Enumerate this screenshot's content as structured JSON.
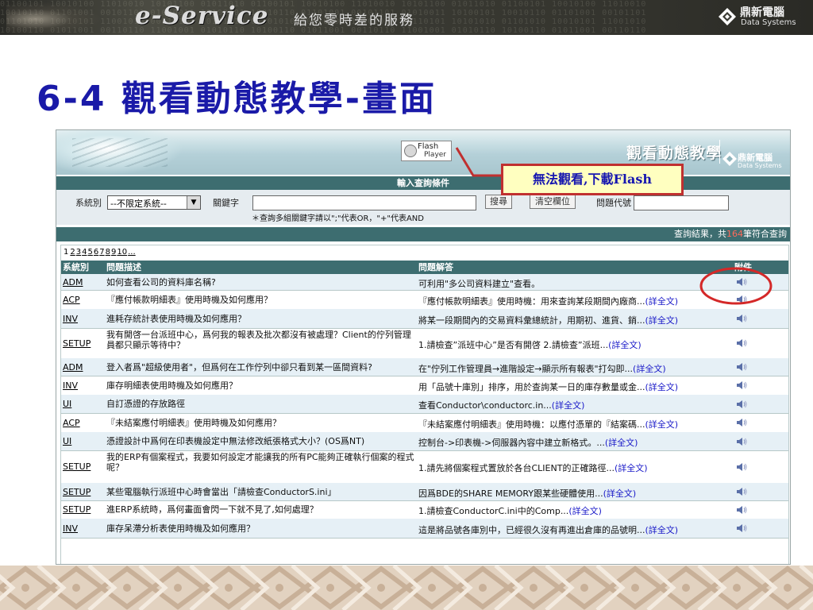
{
  "banner": {
    "logo_text": "e-Service",
    "tagline": "給您零時差的服務",
    "brand_cn": "鼎新電腦",
    "brand_en": "Data Systems"
  },
  "slide_title": "6-4 觀看動態教學-畫面",
  "app": {
    "flash_badge_line1": "Flash",
    "flash_badge_line2": "Player",
    "title": "觀看動態教學",
    "logo_cn": "鼎新電腦",
    "logo_en": "Data Systems",
    "query_title": "輸入查詢條件",
    "query": {
      "system_label": "系統別",
      "system_value": "--不限定系統--",
      "keyword_label": "關鍵字",
      "keyword_value": "",
      "hint": "＊查詢多組關鍵字請以\";\"代表OR，\"+\"代表AND",
      "search_button": "搜尋",
      "clear_button": "清空欄位",
      "code_label": "問題代號",
      "code_value": ""
    },
    "result_prefix": "查詢結果，共",
    "result_count": "164",
    "result_suffix": "筆符合查詢",
    "pager": {
      "current": "1",
      "pages": [
        "2",
        "3",
        "4",
        "5",
        "6",
        "7",
        "8",
        "9",
        "10",
        "..."
      ]
    },
    "columns": {
      "system": "系統別",
      "question": "問題描述",
      "answer": "問題解答",
      "attachment": "附件"
    },
    "rows": [
      {
        "sys": "ADM",
        "q": "如何查看公司的資料庫名稱?",
        "a": "可利用\"多公司資料建立\"查看。",
        "more": ""
      },
      {
        "sys": "ACP",
        "q": "『應付帳款明細表』使用時機及如何應用？",
        "a": "『應付帳款明細表』使用時機：用來查詢某段期間內廠商...",
        "more": "(詳全文)"
      },
      {
        "sys": "INV",
        "q": "進耗存統計表使用時機及如何應用？",
        "a": "將某一段期間內的交易資料彙總統計，用期初、進貨、銷...",
        "more": "(詳全文)"
      },
      {
        "sys": "SETUP",
        "q": "我有開啓一台派班中心，爲何我的報表及批次都沒有被處理？Client的佇列管理員都只顯示等待中？",
        "a": "1.請檢查”派班中心”是否有開啓 2.請檢查”派班...",
        "more": "(詳全文)"
      },
      {
        "sys": "ADM",
        "q": "登入者爲\"超級使用者\"，但爲何在工作佇列中卻只看到某一區間資料?",
        "a": "在\"佇列工作管理員→進階設定→顯示所有報表\"打勾即...",
        "more": "(詳全文)"
      },
      {
        "sys": "INV",
        "q": "庫存明細表使用時機及如何應用？",
        "a": "用「品號十庫別」排序，用於查詢某一日的庫存數量或金...",
        "more": "(詳全文)"
      },
      {
        "sys": "UI",
        "q": "自訂憑證的存放路徑",
        "a": "查看Conductor\\conductorc.in...",
        "more": "(詳全文)"
      },
      {
        "sys": "ACP",
        "q": "『未結案應付明細表』使用時機及如何應用？",
        "a": "『未結案應付明細表』使用時機：以應付憑單的『結案碼...",
        "more": "(詳全文)"
      },
      {
        "sys": "UI",
        "q": "憑證設計中爲何在印表機設定中無法修改紙張格式大小？(OS爲NT)",
        "a": "控制台->印表機->伺服器內容中建立新格式。...",
        "more": "(詳全文)"
      },
      {
        "sys": "SETUP",
        "q": "我的ERP有個案程式，我要如何設定才能讓我的所有PC能夠正確執行個案的程式呢？",
        "a": "1.請先將個案程式置放於各台CLIENT的正確路徑...",
        "more": "(詳全文)"
      },
      {
        "sys": "SETUP",
        "q": "某些電腦執行派班中心時會當出「請檢查ConductorS.ini」",
        "a": "因爲BDE的SHARE MEMORY跟某些硬體使用...",
        "more": "(詳全文)"
      },
      {
        "sys": "SETUP",
        "q": "進ERP系統時，爲何畫面會閃一下就不見了,如何處理？",
        "a": "1.請檢查ConductorC.ini中的Comp...",
        "more": "(詳全文)"
      },
      {
        "sys": "INV",
        "q": "庫存呆滯分析表使用時機及如何應用？",
        "a": "這是將品號各庫別中，已經很久沒有再進出倉庫的品號明...",
        "more": "(詳全文)"
      }
    ]
  },
  "callout": {
    "text": "無法觀看,下載Flash"
  },
  "colors": {
    "accent_bar": "#3d6d70",
    "title_blue": "#1a1aa8",
    "callout_red": "#c03030",
    "link_blue": "#1818c8"
  }
}
